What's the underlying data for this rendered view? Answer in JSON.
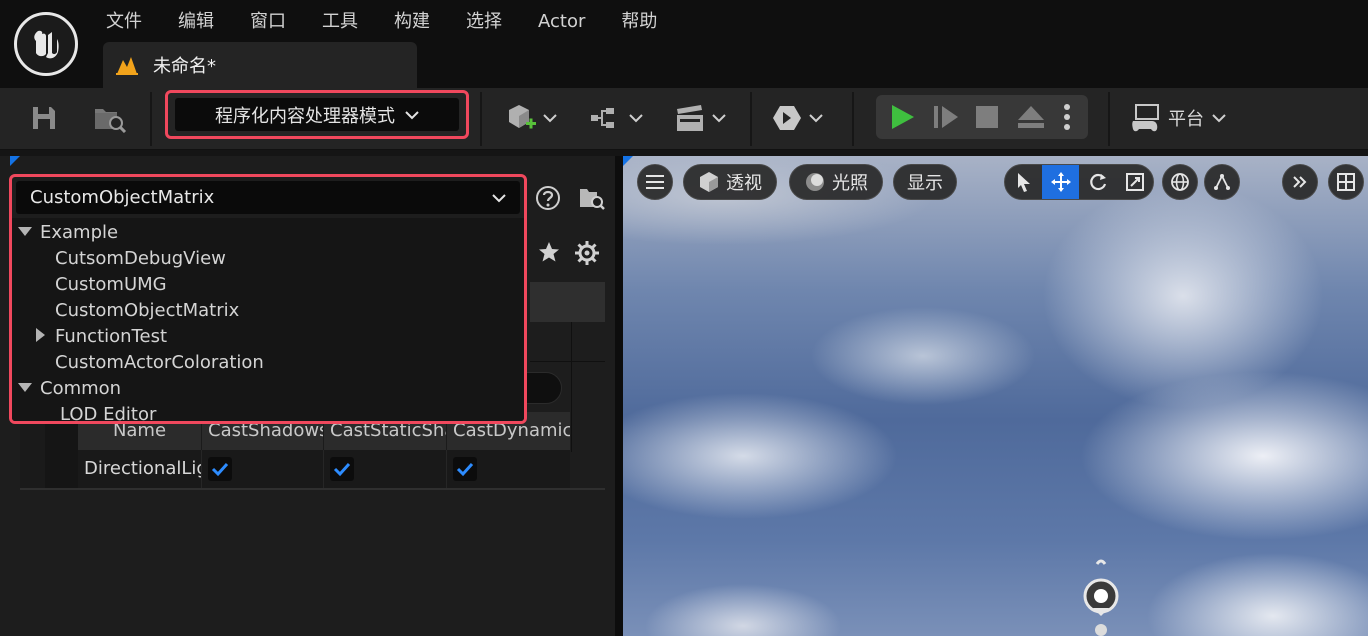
{
  "menu": {
    "items": [
      "文件",
      "编辑",
      "窗口",
      "工具",
      "构建",
      "选择",
      "Actor",
      "帮助"
    ]
  },
  "level_tab": {
    "label": "未命名*"
  },
  "toolbar": {
    "mode_label": "程序化内容处理器模式",
    "platform_label": "平台"
  },
  "outline_dropdown": {
    "selected": "CustomObjectMatrix",
    "groups": [
      {
        "label": "Example",
        "expanded": true,
        "items": [
          {
            "label": "CutsomDebugView"
          },
          {
            "label": "CustomUMG"
          },
          {
            "label": "CustomObjectMatrix"
          },
          {
            "label": "FunctionTest",
            "collapsed_children": true
          },
          {
            "label": "CustomActorColoration"
          }
        ]
      },
      {
        "label": "Common",
        "expanded": true,
        "items": [
          {
            "label": "LOD Editor"
          }
        ]
      }
    ]
  },
  "table": {
    "columns": [
      "Name",
      "CastShadows",
      "CastStaticShadow",
      "CastDynamicShadow"
    ],
    "rows": [
      {
        "name": "DirectionalLight",
        "cast_shadows": true,
        "cast_static": true,
        "cast_dynamic": true
      }
    ]
  },
  "viewport": {
    "perspective_label": "透视",
    "lighting_label": "光照",
    "show_label": "显示"
  },
  "colors": {
    "highlight": "#f0485d",
    "accent_blue": "#1f6fe0",
    "play_green": "#3fbf3f"
  }
}
